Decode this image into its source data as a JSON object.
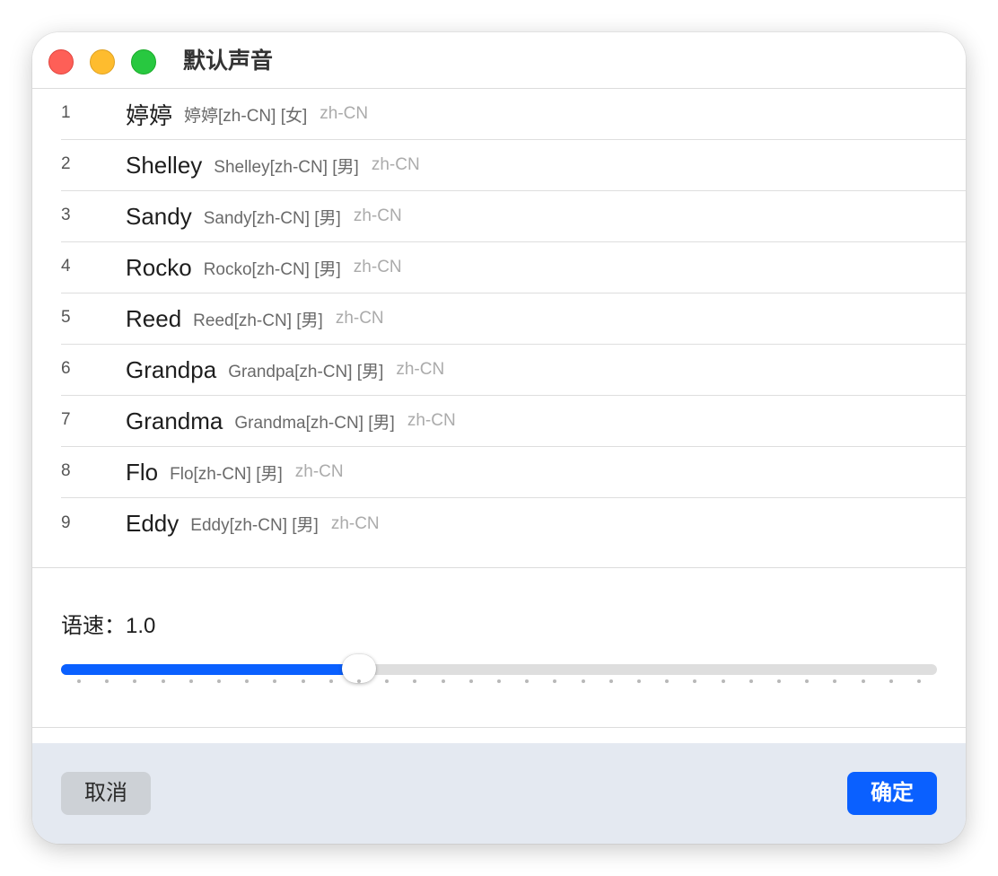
{
  "window": {
    "title": "默认声音"
  },
  "voices": [
    {
      "index": "1",
      "name": "婷婷",
      "detail": "婷婷[zh-CN] [女]",
      "lang": "zh-CN"
    },
    {
      "index": "2",
      "name": "Shelley",
      "detail": "Shelley[zh-CN] [男]",
      "lang": "zh-CN"
    },
    {
      "index": "3",
      "name": "Sandy",
      "detail": "Sandy[zh-CN] [男]",
      "lang": "zh-CN"
    },
    {
      "index": "4",
      "name": "Rocko",
      "detail": "Rocko[zh-CN] [男]",
      "lang": "zh-CN"
    },
    {
      "index": "5",
      "name": "Reed",
      "detail": "Reed[zh-CN] [男]",
      "lang": "zh-CN"
    },
    {
      "index": "6",
      "name": "Grandpa",
      "detail": "Grandpa[zh-CN] [男]",
      "lang": "zh-CN"
    },
    {
      "index": "7",
      "name": "Grandma",
      "detail": "Grandma[zh-CN] [男]",
      "lang": "zh-CN"
    },
    {
      "index": "8",
      "name": "Flo",
      "detail": "Flo[zh-CN] [男]",
      "lang": "zh-CN"
    },
    {
      "index": "9",
      "name": "Eddy",
      "detail": "Eddy[zh-CN] [男]",
      "lang": "zh-CN"
    }
  ],
  "speed": {
    "label": "语速：1.0",
    "value": 1.0,
    "fraction": 0.34,
    "tick_count": 31
  },
  "buttons": {
    "cancel_label": "取消",
    "ok_label": "确定"
  },
  "colors": {
    "accent": "#0a60ff",
    "close": "#fe5f57",
    "minimize": "#febc2e",
    "zoom": "#28c840",
    "footer_bg": "#e4e9f1"
  },
  "icons": {
    "close": "close-dot-icon",
    "minimize": "minimize-dot-icon",
    "zoom": "zoom-dot-icon"
  }
}
